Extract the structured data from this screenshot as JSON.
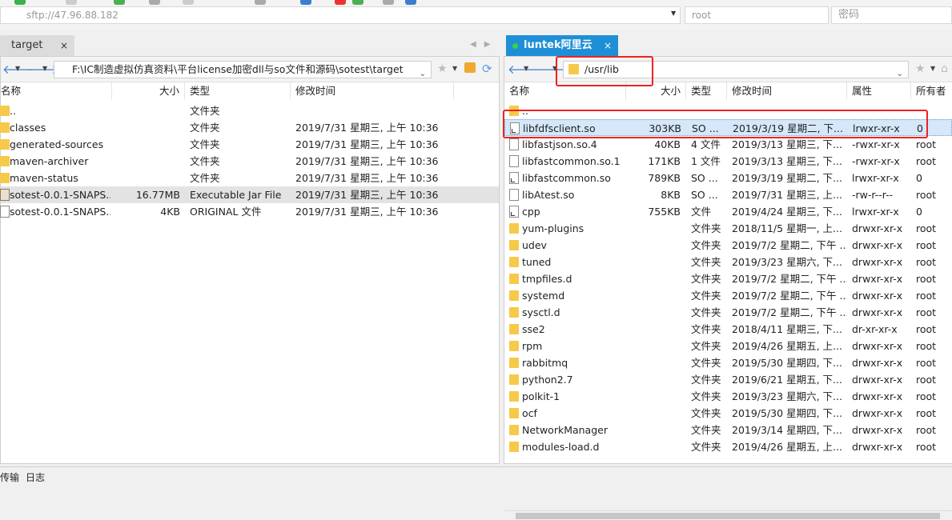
{
  "address": {
    "host": "sftp://47.96.88.182",
    "user": "root",
    "password_placeholder": "密码"
  },
  "tabs": {
    "left": {
      "label": "target",
      "close": "×"
    },
    "right": {
      "label": "luntek阿里云",
      "close": "×"
    }
  },
  "left_pane": {
    "path": "F:\\IC制造虚拟仿真资料\\平台license加密dll与so文件和源码\\sotest\\target",
    "columns": {
      "name": "名称",
      "size": "大小",
      "type": "类型",
      "modified": "修改时间"
    },
    "rows": [
      {
        "name": "..",
        "size": "",
        "type": "文件夹",
        "modified": "",
        "icon": "folder"
      },
      {
        "name": "classes",
        "size": "",
        "type": "文件夹",
        "modified": "2019/7/31 星期三, 上午 10:36",
        "icon": "folder"
      },
      {
        "name": "generated-sources",
        "size": "",
        "type": "文件夹",
        "modified": "2019/7/31 星期三, 上午 10:36",
        "icon": "folder"
      },
      {
        "name": "maven-archiver",
        "size": "",
        "type": "文件夹",
        "modified": "2019/7/31 星期三, 上午 10:36",
        "icon": "folder"
      },
      {
        "name": "maven-status",
        "size": "",
        "type": "文件夹",
        "modified": "2019/7/31 星期三, 上午 10:36",
        "icon": "folder"
      },
      {
        "name": "sotest-0.0.1-SNAPS...",
        "size": "16.77MB",
        "type": "Executable Jar File",
        "modified": "2019/7/31 星期三, 上午 10:36",
        "icon": "jar"
      },
      {
        "name": "sotest-0.0.1-SNAPS...",
        "size": "4KB",
        "type": "ORIGINAL 文件",
        "modified": "2019/7/31 星期三, 上午 10:36",
        "icon": "file"
      }
    ]
  },
  "right_pane": {
    "path": "/usr/lib",
    "columns": {
      "name": "名称",
      "size": "大小",
      "type": "类型",
      "modified": "修改时间",
      "attr": "属性",
      "owner": "所有者"
    },
    "rows": [
      {
        "name": "..",
        "size": "",
        "type": "",
        "modified": "",
        "attr": "",
        "owner": "",
        "icon": "folder"
      },
      {
        "name": "libfdfsclient.so",
        "size": "303KB",
        "type": "SO ...",
        "modified": "2019/3/19 星期二, 下...",
        "attr": "lrwxr-xr-x",
        "owner": "0",
        "icon": "link"
      },
      {
        "name": "libfastjson.so.4",
        "size": "40KB",
        "type": "4 文件",
        "modified": "2019/3/13 星期三, 下...",
        "attr": "-rwxr-xr-x",
        "owner": "root",
        "icon": "file"
      },
      {
        "name": "libfastcommon.so.1",
        "size": "171KB",
        "type": "1 文件",
        "modified": "2019/3/13 星期三, 下...",
        "attr": "-rwxr-xr-x",
        "owner": "root",
        "icon": "file"
      },
      {
        "name": "libfastcommon.so",
        "size": "789KB",
        "type": "SO ...",
        "modified": "2019/3/19 星期二, 下...",
        "attr": "lrwxr-xr-x",
        "owner": "0",
        "icon": "link"
      },
      {
        "name": "libAtest.so",
        "size": "8KB",
        "type": "SO ...",
        "modified": "2019/7/31 星期三, 上...",
        "attr": "-rw-r--r--",
        "owner": "root",
        "icon": "file"
      },
      {
        "name": "cpp",
        "size": "755KB",
        "type": "文件",
        "modified": "2019/4/24 星期三, 下...",
        "attr": "lrwxr-xr-x",
        "owner": "0",
        "icon": "link"
      },
      {
        "name": "yum-plugins",
        "size": "",
        "type": "文件夹",
        "modified": "2018/11/5 星期一, 上...",
        "attr": "drwxr-xr-x",
        "owner": "root",
        "icon": "folder"
      },
      {
        "name": "udev",
        "size": "",
        "type": "文件夹",
        "modified": "2019/7/2 星期二, 下午 ...",
        "attr": "drwxr-xr-x",
        "owner": "root",
        "icon": "folder"
      },
      {
        "name": "tuned",
        "size": "",
        "type": "文件夹",
        "modified": "2019/3/23 星期六, 下...",
        "attr": "drwxr-xr-x",
        "owner": "root",
        "icon": "folder"
      },
      {
        "name": "tmpfiles.d",
        "size": "",
        "type": "文件夹",
        "modified": "2019/7/2 星期二, 下午 ...",
        "attr": "drwxr-xr-x",
        "owner": "root",
        "icon": "folder"
      },
      {
        "name": "systemd",
        "size": "",
        "type": "文件夹",
        "modified": "2019/7/2 星期二, 下午 ...",
        "attr": "drwxr-xr-x",
        "owner": "root",
        "icon": "folder"
      },
      {
        "name": "sysctl.d",
        "size": "",
        "type": "文件夹",
        "modified": "2019/7/2 星期二, 下午 ...",
        "attr": "drwxr-xr-x",
        "owner": "root",
        "icon": "folder"
      },
      {
        "name": "sse2",
        "size": "",
        "type": "文件夹",
        "modified": "2018/4/11 星期三, 下...",
        "attr": "dr-xr-xr-x",
        "owner": "root",
        "icon": "folder"
      },
      {
        "name": "rpm",
        "size": "",
        "type": "文件夹",
        "modified": "2019/4/26 星期五, 上...",
        "attr": "drwxr-xr-x",
        "owner": "root",
        "icon": "folder"
      },
      {
        "name": "rabbitmq",
        "size": "",
        "type": "文件夹",
        "modified": "2019/5/30 星期四, 下...",
        "attr": "drwxr-xr-x",
        "owner": "root",
        "icon": "folder"
      },
      {
        "name": "python2.7",
        "size": "",
        "type": "文件夹",
        "modified": "2019/6/21 星期五, 下...",
        "attr": "drwxr-xr-x",
        "owner": "root",
        "icon": "folder"
      },
      {
        "name": "polkit-1",
        "size": "",
        "type": "文件夹",
        "modified": "2019/3/23 星期六, 下...",
        "attr": "drwxr-xr-x",
        "owner": "root",
        "icon": "folder"
      },
      {
        "name": "ocf",
        "size": "",
        "type": "文件夹",
        "modified": "2019/5/30 星期四, 下...",
        "attr": "drwxr-xr-x",
        "owner": "root",
        "icon": "folder"
      },
      {
        "name": "NetworkManager",
        "size": "",
        "type": "文件夹",
        "modified": "2019/3/14 星期四, 下...",
        "attr": "drwxr-xr-x",
        "owner": "root",
        "icon": "folder"
      },
      {
        "name": "modules-load.d",
        "size": "",
        "type": "文件夹",
        "modified": "2019/4/26 星期五, 上...",
        "attr": "drwxr-xr-x",
        "owner": "root",
        "icon": "folder"
      }
    ]
  },
  "bottom_tabs": {
    "transfer": "传输",
    "log": "日志"
  }
}
